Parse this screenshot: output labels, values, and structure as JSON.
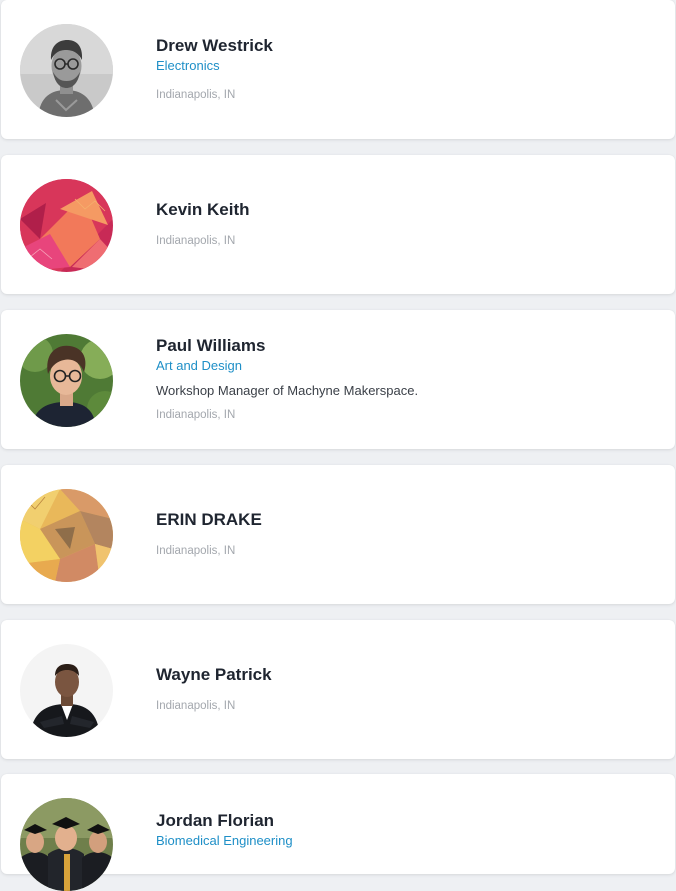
{
  "profiles": [
    {
      "name": "Drew Westrick",
      "category": "Electronics",
      "bio": "",
      "location": "Indianapolis, IN",
      "avatar_icon": "person-photo-bw"
    },
    {
      "name": "Kevin Keith",
      "category": "",
      "bio": "",
      "location": "Indianapolis, IN",
      "avatar_icon": "abstract-red-pattern"
    },
    {
      "name": "Paul Williams",
      "category": "Art and Design",
      "bio": "Workshop Manager of Machyne Makerspace.",
      "location": "Indianapolis, IN",
      "avatar_icon": "person-photo-color"
    },
    {
      "name": "ERIN DRAKE",
      "category": "",
      "bio": "",
      "location": "Indianapolis, IN",
      "avatar_icon": "abstract-gold-pattern"
    },
    {
      "name": "Wayne Patrick",
      "category": "",
      "bio": "",
      "location": "Indianapolis, IN",
      "avatar_icon": "person-photo-suit"
    },
    {
      "name": "Jordan Florian",
      "category": "Biomedical Engineering",
      "bio": "",
      "location": "",
      "avatar_icon": "group-photo-graduation"
    }
  ],
  "colors": {
    "background": "#eef0f3",
    "card": "#ffffff",
    "name": "#1f2530",
    "category": "#1e8fc7",
    "bio": "#3b4048",
    "location": "#a3a7ad"
  }
}
